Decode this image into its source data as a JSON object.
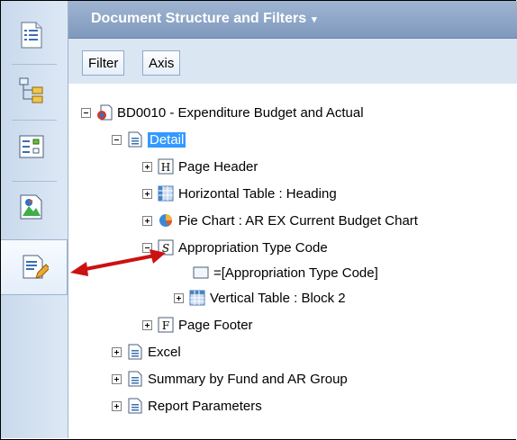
{
  "header": {
    "title": "Document Structure and Filters",
    "caret": "▾"
  },
  "tabs": [
    {
      "label": "Filter"
    },
    {
      "label": "Axis"
    }
  ],
  "tree": [
    {
      "label": "BD0010 - Expenditure Budget and Actual"
    },
    {
      "label": "Detail"
    },
    {
      "label": "Page Header",
      "icon_letter": "H"
    },
    {
      "label": "Horizontal Table : Heading"
    },
    {
      "label": "Pie Chart : AR EX Current Budget Chart"
    },
    {
      "label": "Appropriation Type Code",
      "icon_letter": "S"
    },
    {
      "label": "=[Appropriation Type Code]"
    },
    {
      "label": "Vertical Table : Block 2"
    },
    {
      "label": "Page Footer",
      "icon_letter": "F"
    },
    {
      "label": "Excel"
    },
    {
      "label": "Summary by Fund and AR Group"
    },
    {
      "label": "Report Parameters"
    }
  ],
  "colors": {
    "header_bg": "#8aa3c4",
    "selection": "#3399ff",
    "arrow": "#cc1111"
  }
}
